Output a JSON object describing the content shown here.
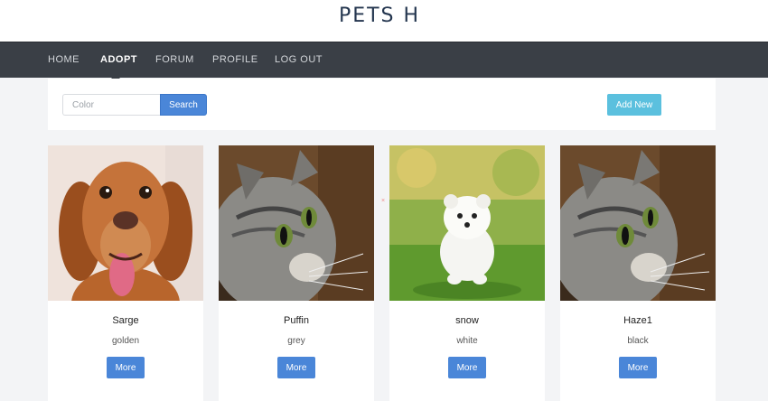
{
  "header": {
    "title": "PETS H"
  },
  "nav": {
    "items": [
      {
        "label": "HOME",
        "active": false
      },
      {
        "label": "ADOPT",
        "active": true
      },
      {
        "label": "FORUM",
        "active": false
      },
      {
        "label": "PROFILE",
        "active": false
      },
      {
        "label": "LOG OUT",
        "active": false
      }
    ]
  },
  "toolbar": {
    "color_placeholder": "Color",
    "color_value": "",
    "search_label": "Search",
    "add_label": "Add New"
  },
  "pets": [
    {
      "name": "Sarge",
      "color": "golden",
      "more_label": "More",
      "photo_icon": "dog-photo"
    },
    {
      "name": "Puffin",
      "color": "grey",
      "more_label": "More",
      "photo_icon": "cat-photo"
    },
    {
      "name": "snow",
      "color": "white",
      "more_label": "More",
      "photo_icon": "puppy-photo"
    },
    {
      "name": "Haze1",
      "color": "black",
      "more_label": "More",
      "photo_icon": "cat-photo"
    }
  ],
  "colors": {
    "nav_bg": "#3a3f46",
    "primary_button": "#4a86d8",
    "info_button": "#5bc0de",
    "title_text": "#24364f"
  }
}
